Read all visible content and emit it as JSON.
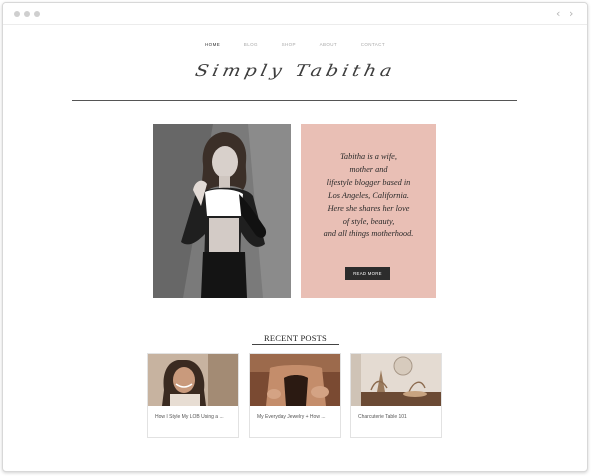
{
  "browser": {
    "back_icon": "‹",
    "forward_icon": "›"
  },
  "nav": {
    "items": [
      {
        "label": "HOME"
      },
      {
        "label": "BLOG"
      },
      {
        "label": "SHOP"
      },
      {
        "label": "ABOUT"
      },
      {
        "label": "CONTACT"
      }
    ]
  },
  "site": {
    "logo_text": "Simply Tabitha"
  },
  "bio": {
    "lines": [
      "Tabitha is a wife,",
      "mother and",
      "lifestyle blogger based in",
      "Los Angeles, California.",
      "Here she shares her love",
      "of style, beauty,",
      "and all things motherhood."
    ],
    "button_label": "READ MORE"
  },
  "recent": {
    "title": "RECENT POSTS",
    "posts": [
      {
        "caption": "How I Style My LOB Using a ..."
      },
      {
        "caption": "My Everyday Jewelry + How ..."
      },
      {
        "caption": "Charcuterie Table 101"
      }
    ]
  },
  "colors": {
    "bio_background": "#e9bfb5",
    "button_background": "#2c2c2c",
    "rule": "#555555"
  }
}
